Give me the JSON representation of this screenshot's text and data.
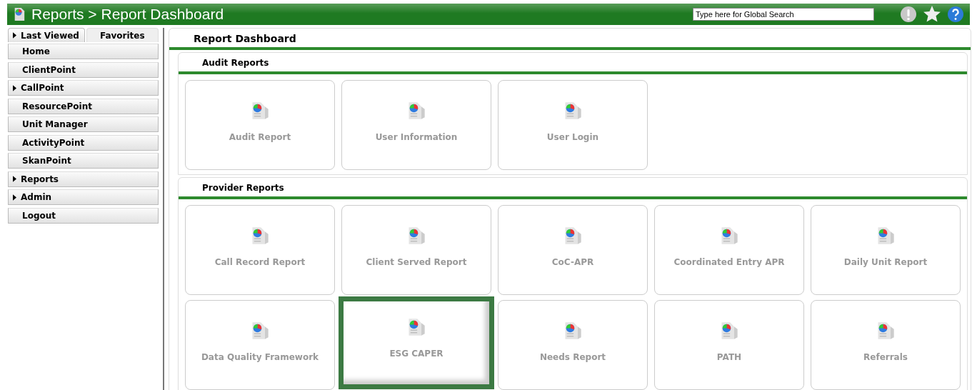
{
  "header": {
    "title": "Reports > Report Dashboard",
    "search": {
      "placeholder": "Type here for Global Search"
    }
  },
  "sidebar": {
    "tabs": [
      {
        "label": "Last Viewed",
        "selected": true,
        "expandable": true
      },
      {
        "label": "Favorites",
        "selected": false,
        "expandable": false
      }
    ],
    "items": [
      {
        "label": "Home",
        "expandable": false
      },
      {
        "label": "ClientPoint",
        "expandable": false
      },
      {
        "label": "CallPoint",
        "expandable": true
      },
      {
        "label": "ResourcePoint",
        "expandable": false
      },
      {
        "label": "Unit Manager",
        "expandable": false
      },
      {
        "label": "ActivityPoint",
        "expandable": false
      },
      {
        "label": "SkanPoint",
        "expandable": false
      },
      {
        "label": "Reports",
        "expandable": true
      },
      {
        "label": "Admin",
        "expandable": true
      },
      {
        "label": "Logout",
        "expandable": false
      }
    ]
  },
  "main": {
    "title": "Report Dashboard",
    "sections": [
      {
        "title": "Audit Reports",
        "tiles": [
          {
            "label": "Audit Report",
            "selected": false
          },
          {
            "label": "User Information",
            "selected": false
          },
          {
            "label": "User Login",
            "selected": false
          }
        ]
      },
      {
        "title": "Provider Reports",
        "tiles": [
          {
            "label": "Call Record Report",
            "selected": false
          },
          {
            "label": "Client Served Report",
            "selected": false
          },
          {
            "label": "CoC-APR",
            "selected": false
          },
          {
            "label": "Coordinated Entry APR",
            "selected": false
          },
          {
            "label": "Daily Unit Report",
            "selected": false
          },
          {
            "label": "Data Quality Framework",
            "selected": false
          },
          {
            "label": "ESG CAPER",
            "selected": true
          },
          {
            "label": "Needs Report",
            "selected": false
          },
          {
            "label": "PATH",
            "selected": false
          },
          {
            "label": "Referrals",
            "selected": false
          }
        ]
      }
    ]
  }
}
